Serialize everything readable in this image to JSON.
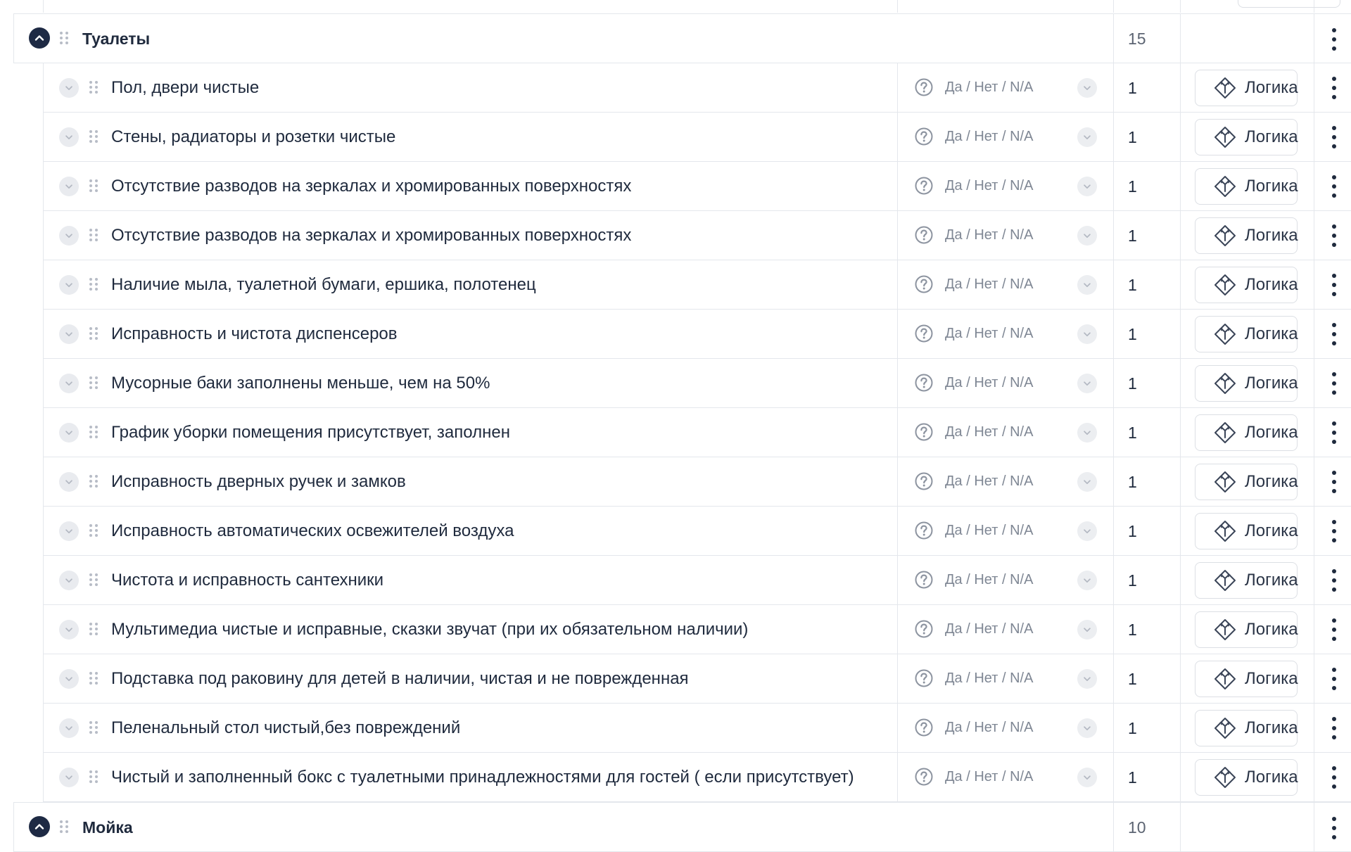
{
  "sections": [
    {
      "title": "Туалеты",
      "score": "15",
      "items": [
        {
          "title": "Пол, двери чистые",
          "response": "Да / Нет / N/A",
          "score": "1",
          "logic": "Логика"
        },
        {
          "title": "Стены, радиаторы и розетки чистые",
          "response": "Да / Нет / N/A",
          "score": "1",
          "logic": "Логика"
        },
        {
          "title": "Отсутствие разводов на зеркалах и хромированных поверхностях",
          "response": "Да / Нет / N/A",
          "score": "1",
          "logic": "Логика"
        },
        {
          "title": "Отсутствие разводов на зеркалах и хромированных поверхностях",
          "response": "Да / Нет / N/A",
          "score": "1",
          "logic": "Логика"
        },
        {
          "title": "Наличие мыла, туалетной бумаги, ершика, полотенец",
          "response": "Да / Нет / N/A",
          "score": "1",
          "logic": "Логика"
        },
        {
          "title": "Исправность и чистота диспенсеров",
          "response": "Да / Нет / N/A",
          "score": "1",
          "logic": "Логика"
        },
        {
          "title": "Мусорные баки заполнены меньше, чем на 50%",
          "response": "Да / Нет / N/A",
          "score": "1",
          "logic": "Логика"
        },
        {
          "title": "График уборки помещения присутствует, заполнен",
          "response": "Да / Нет / N/A",
          "score": "1",
          "logic": "Логика"
        },
        {
          "title": "Исправность дверных ручек и замков",
          "response": "Да / Нет / N/A",
          "score": "1",
          "logic": "Логика"
        },
        {
          "title": "Исправность автоматических освежителей воздуха",
          "response": "Да / Нет / N/A",
          "score": "1",
          "logic": "Логика"
        },
        {
          "title": "Чистота и исправность сантехники",
          "response": "Да / Нет / N/A",
          "score": "1",
          "logic": "Логика"
        },
        {
          "title": "Мультимедиа чистые и исправные, сказки звучат (при их обязательном наличии)",
          "response": "Да / Нет / N/A",
          "score": "1",
          "logic": "Логика"
        },
        {
          "title": "Подставка под раковину для детей в наличии, чистая и не поврежденная",
          "response": "Да / Нет / N/A",
          "score": "1",
          "logic": "Логика"
        },
        {
          "title": "Пеленальный стол чистый,без повреждений",
          "response": "Да / Нет / N/A",
          "score": "1",
          "logic": "Логика"
        },
        {
          "title": "Чистый и заполненный бокс с туалетными принадлежностями для гостей ( если присутствует)",
          "response": "Да / Нет / N/A",
          "score": "1",
          "logic": "Логика"
        }
      ]
    },
    {
      "title": "Мойка",
      "score": "10",
      "items": []
    }
  ],
  "icons": {
    "section_toggle": "chevron-up-icon",
    "item_toggle": "chevron-down-icon",
    "drag": "drag-handle-icon",
    "question": "question-circle-icon",
    "logic": "diamond-arrows-icon",
    "menu": "kebab-menu-icon"
  },
  "colors": {
    "accent": "#1e2a44",
    "border": "#e4e7ec",
    "muted_text": "#7f8794"
  }
}
